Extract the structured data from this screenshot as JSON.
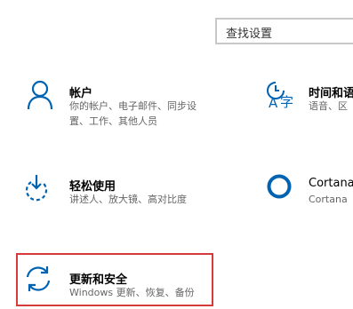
{
  "search": {
    "placeholder": "查找设置"
  },
  "tiles": [
    {
      "title": "帐户",
      "desc": [
        "你的帐户、电子邮件、同步设",
        "置、工作、其他人员"
      ],
      "icon": "person-icon"
    },
    {
      "title": "时间和语",
      "desc": [
        "语音、区"
      ],
      "icon": "time-language-icon"
    },
    {
      "title": "轻松使用",
      "desc": [
        "讲述人、放大镜、高对比度"
      ],
      "icon": "ease-of-access-icon"
    },
    {
      "title": "Cortana",
      "desc": [
        "Cortana"
      ],
      "icon": "cortana-icon"
    },
    {
      "title": "更新和安全",
      "desc": [
        "Windows 更新、恢复、备份"
      ],
      "icon": "sync-icon"
    }
  ],
  "colors": {
    "accent": "#0063b1",
    "highlight": "#d63a3a"
  }
}
